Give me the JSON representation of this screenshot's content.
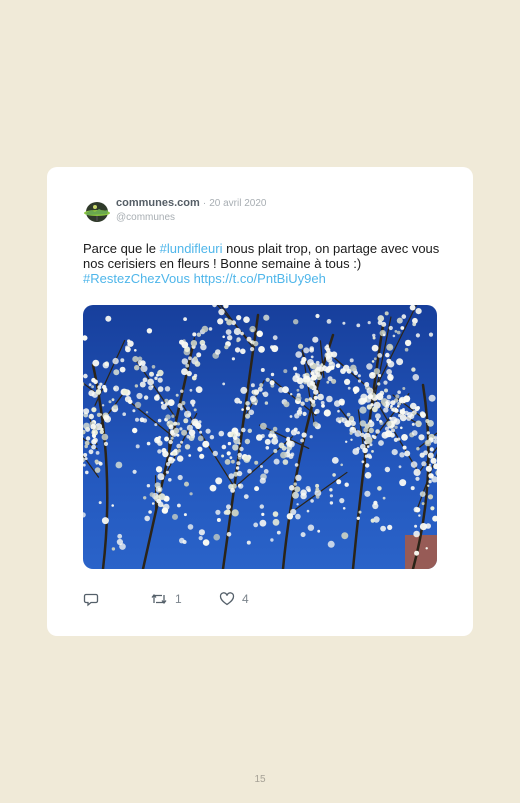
{
  "tweet": {
    "author_name": "communes.com",
    "separator": "·",
    "date": "20 avril 2020",
    "handle": "@communes",
    "text_before": "Parce que le ",
    "hashtag_1": "#lundifleuri",
    "text_after": " nous plait trop, on partage avec vous nos cerisiers en fleurs ! Bonne semaine à tous :)",
    "hashtag_2": "#RestezChezVous",
    "url": "https://t.co/PntBiUy9eh",
    "retweet_count": "1",
    "like_count": "4"
  },
  "icons": {
    "reply": "reply-icon",
    "retweet": "retweet-icon",
    "like": "heart-icon",
    "avatar": "communes-logo"
  },
  "colors": {
    "background": "#f0ead8",
    "card": "#ffffff",
    "link": "#4fb6ea",
    "sky": "#1f4fb5"
  },
  "footer": {
    "page_number": "15"
  }
}
